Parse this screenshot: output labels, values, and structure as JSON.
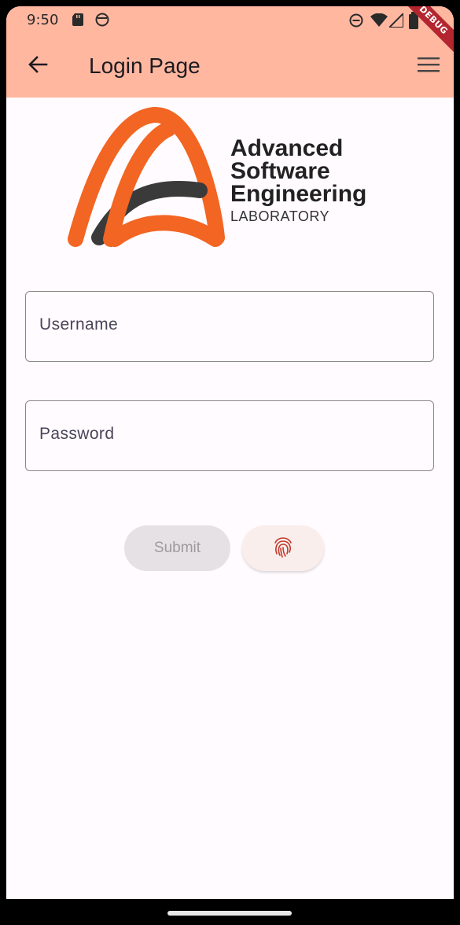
{
  "status_bar": {
    "time": "9:50",
    "icons": [
      "sd-card-icon",
      "face-icon",
      "do-not-disturb-icon",
      "wifi-icon",
      "signal-icon",
      "battery-icon"
    ]
  },
  "debug_banner": "DEBUG",
  "app_bar": {
    "title": "Login Page",
    "back_icon": "arrow-left-icon",
    "menu_icon": "menu-icon",
    "background": "#ffb7a0"
  },
  "logo": {
    "lines": [
      "Advanced",
      "Software",
      "Engineering"
    ],
    "subtitle": "LABORATORY",
    "accent": "#f26522",
    "dark": "#3a3a3a"
  },
  "form": {
    "username_placeholder": "Username",
    "password_placeholder": "Password",
    "submit_label": "Submit",
    "fingerprint_icon": "fingerprint-icon"
  }
}
